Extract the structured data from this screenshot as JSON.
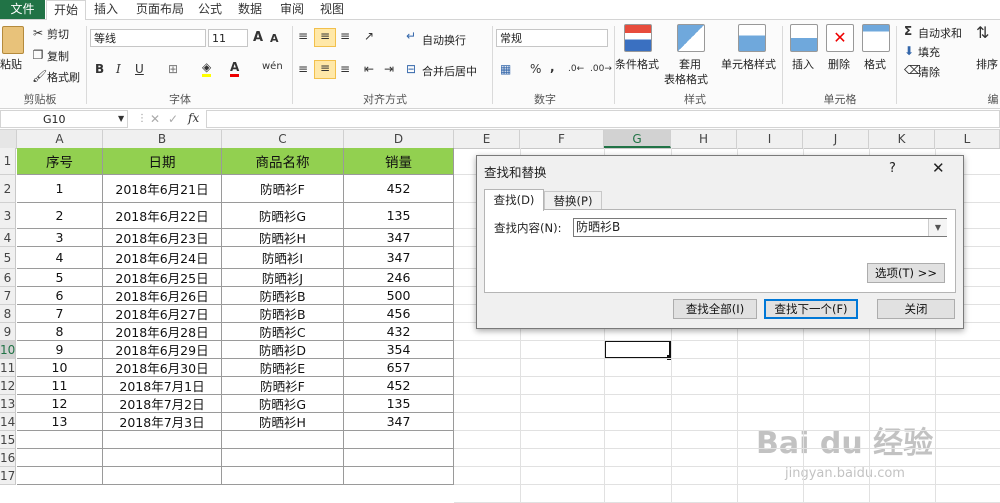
{
  "tabs": [
    "文件",
    "开始",
    "插入",
    "页面布局",
    "公式",
    "数据",
    "审阅",
    "视图"
  ],
  "ribbon": {
    "clipboard": {
      "paste": "粘贴",
      "cut": "剪切",
      "copy": "复制",
      "format_painter": "格式刷",
      "label": "剪贴板"
    },
    "font": {
      "name": "等线",
      "size": "11",
      "grow": "A",
      "shrink": "A",
      "bold": "B",
      "italic": "I",
      "underline": "U",
      "label": "字体"
    },
    "alignment": {
      "wrap": "自动换行",
      "merge": "合并后居中",
      "label": "对齐方式"
    },
    "number": {
      "format": "常规",
      "percent": "%",
      "comma": ",",
      "label": "数字"
    },
    "styles": {
      "conditional": "条件格式",
      "table1": "套用",
      "table2": "表格格式",
      "cell_styles": "单元格样式",
      "label": "样式"
    },
    "cells": {
      "insert": "插入",
      "delete": "删除",
      "format": "格式",
      "label": "单元格"
    },
    "editing": {
      "autosum": "自动求和",
      "fill": "填充",
      "clear": "清除",
      "sort": "排序",
      "label": "编"
    }
  },
  "formula_bar": {
    "name_box": "G10",
    "fx": "fx",
    "value": ""
  },
  "columns": [
    "A",
    "B",
    "C",
    "D",
    "E",
    "F",
    "G",
    "H",
    "I",
    "J",
    "K",
    "L"
  ],
  "rows": [
    "1",
    "2",
    "3",
    "4",
    "5",
    "6",
    "7",
    "8",
    "9",
    "10",
    "11",
    "12",
    "13",
    "14",
    "15",
    "16",
    "17"
  ],
  "table": {
    "headers": [
      "序号",
      "日期",
      "商品名称",
      "销量"
    ],
    "data": [
      [
        "1",
        "2018年6月21日",
        "防晒衫F",
        "452"
      ],
      [
        "2",
        "2018年6月22日",
        "防晒衫G",
        "135"
      ],
      [
        "3",
        "2018年6月23日",
        "防晒衫H",
        "347"
      ],
      [
        "4",
        "2018年6月24日",
        "防晒衫I",
        "347"
      ],
      [
        "5",
        "2018年6月25日",
        "防晒衫J",
        "246"
      ],
      [
        "6",
        "2018年6月26日",
        "防晒衫B",
        "500"
      ],
      [
        "7",
        "2018年6月27日",
        "防晒衫B",
        "456"
      ],
      [
        "8",
        "2018年6月28日",
        "防晒衫C",
        "432"
      ],
      [
        "9",
        "2018年6月29日",
        "防晒衫D",
        "354"
      ],
      [
        "10",
        "2018年6月30日",
        "防晒衫E",
        "657"
      ],
      [
        "11",
        "2018年7月1日",
        "防晒衫F",
        "452"
      ],
      [
        "12",
        "2018年7月2日",
        "防晒衫G",
        "135"
      ],
      [
        "13",
        "2018年7月3日",
        "防晒衫H",
        "347"
      ]
    ]
  },
  "dialog": {
    "title": "查找和替换",
    "help": "?",
    "close": "✕",
    "tab_find": "查找(D)",
    "tab_replace": "替换(P)",
    "find_label": "查找内容(N):",
    "find_value": "防晒衫B",
    "options": "选项(T) >>",
    "find_all": "查找全部(I)",
    "find_next": "查找下一个(F)",
    "close_btn": "关闭"
  },
  "watermark": {
    "brand": "Bai du 经验",
    "url": "jingyan.baidu.com"
  },
  "colors": {
    "excel_green": "#217346",
    "header_fill": "#92d050"
  }
}
